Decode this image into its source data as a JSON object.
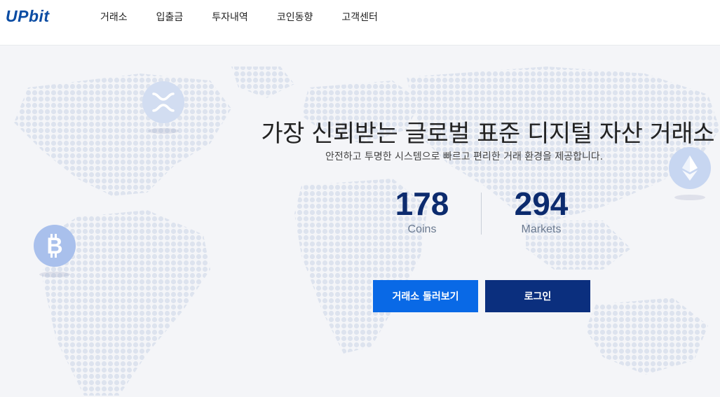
{
  "header": {
    "logo": "UPbit",
    "nav": [
      "거래소",
      "입출금",
      "투자내역",
      "코인동향",
      "고객센터"
    ]
  },
  "hero": {
    "title": "가장 신뢰받는 글로벌 표준 디지털 자산 거래소",
    "subtitle": "안전하고 투명한 시스템으로 빠르고 편리한 거래 환경을 제공합니다.",
    "stats": [
      {
        "value": "178",
        "label": "Coins"
      },
      {
        "value": "294",
        "label": "Markets"
      }
    ],
    "buttons": {
      "explore": "거래소 둘러보기",
      "login": "로그인"
    }
  },
  "icons": {
    "ripple": "ripple-coin-icon",
    "bitcoin": "bitcoin-coin-icon",
    "ethereum": "ethereum-coin-icon"
  },
  "colors": {
    "brand": "#0b4ca3",
    "primary_button": "#0969e6",
    "secondary_button": "#0b2f7e",
    "stat_value": "#0c2b6e",
    "coin": "#a9c0ec"
  }
}
